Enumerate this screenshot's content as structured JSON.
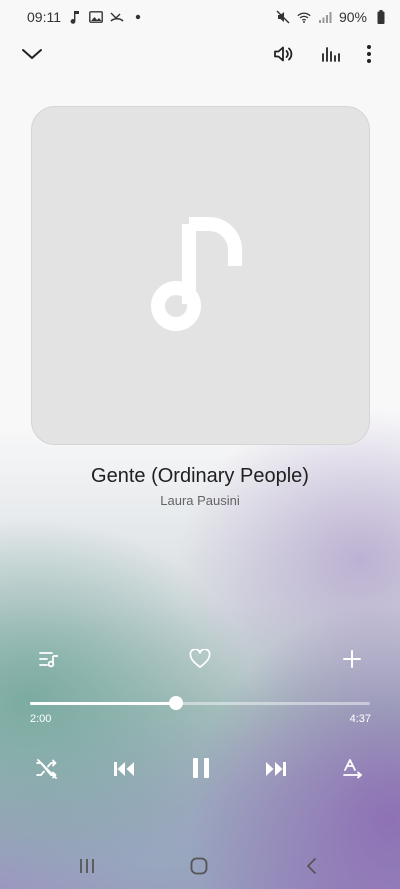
{
  "status_bar": {
    "time": "09:11",
    "battery": "90%",
    "left_icons": [
      "music-note-icon",
      "image-icon",
      "missed-call-icon",
      "dot-icon"
    ],
    "right_icons": [
      "mute-icon",
      "wifi-icon",
      "signal-icon",
      "battery-icon"
    ]
  },
  "player": {
    "title": "Gente (Ordinary People)",
    "artist": "Laura Pausini",
    "elapsed": "2:00",
    "duration": "4:37",
    "progress_fraction": 0.43
  },
  "icons": {
    "collapse": "chevron-down-icon",
    "volume": "volume-icon",
    "equalizer": "equalizer-icon",
    "more": "more-vertical-icon",
    "queue": "queue-icon",
    "favorite": "heart-icon",
    "add": "plus-icon",
    "shuffle": "shuffle-off-icon",
    "previous": "previous-icon",
    "pause": "pause-icon",
    "next": "next-icon",
    "repeat": "repeat-icon",
    "nav_recent": "recent-apps-icon",
    "nav_home": "home-icon",
    "nav_back": "back-icon"
  },
  "colors": {
    "gradient_teal": "#78aaa0",
    "gradient_purple": "#8c6eb4",
    "artwork_bg": "#e3e3e4"
  }
}
